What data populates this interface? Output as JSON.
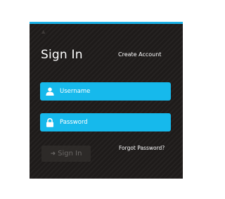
{
  "login": {
    "title": "Sign In",
    "create_account_label": "Create Account",
    "username_placeholder": "Username",
    "password_placeholder": "Password",
    "sign_in_label": "Sign In",
    "forgot_password_label": "Forgot Password?"
  },
  "icons": {
    "username": "user-icon",
    "password": "lock-icon",
    "sign_in": "arrow-right-icon"
  },
  "colors": {
    "accent": "#1ab2e8",
    "field_background": "#16b9ec",
    "card_background": "#1e1b1a",
    "button_background": "#2d2a28",
    "button_text": "#6b6866"
  }
}
